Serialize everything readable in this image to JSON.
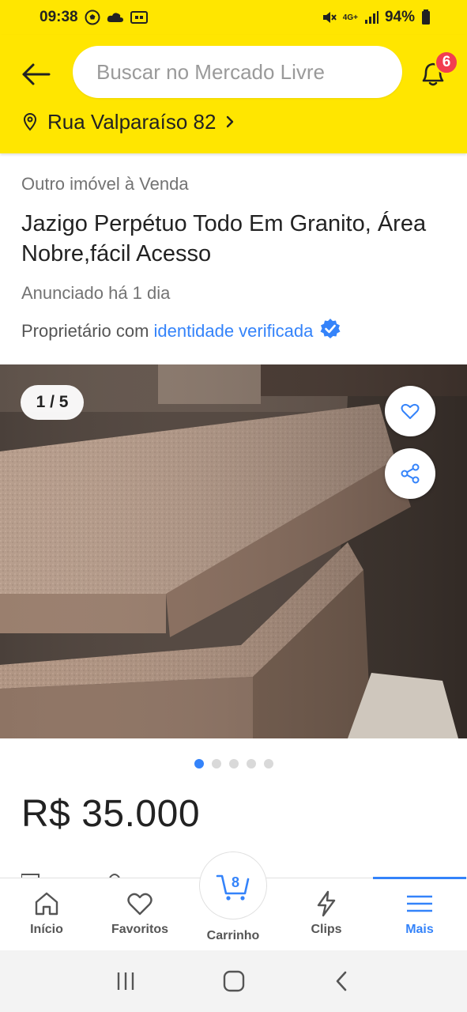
{
  "status_bar": {
    "time": "09:38",
    "network": "4G+",
    "battery": "94%"
  },
  "header": {
    "search_placeholder": "Buscar no Mercado Livre",
    "notifications_count": "6",
    "address": "Rua Valparaíso 82"
  },
  "listing": {
    "category": "Outro imóvel à Venda",
    "title": "Jazigo Perpétuo Todo Em Granito, Área Nobre,fácil Acesso",
    "posted": "Anunciado há 1 dia",
    "owner_prefix": "Proprietário com ",
    "owner_link": "identidade verificada",
    "image_counter": "1 / 5",
    "image_total": 5,
    "image_active_index": 1,
    "price": "R$ 35.000"
  },
  "bottom_nav": {
    "items": [
      {
        "label": "Início",
        "icon": "home-icon"
      },
      {
        "label": "Favoritos",
        "icon": "heart-icon"
      },
      {
        "label": "Carrinho",
        "icon": "cart-icon",
        "badge": "8"
      },
      {
        "label": "Clips",
        "icon": "lightning-icon"
      },
      {
        "label": "Mais",
        "icon": "menu-icon",
        "active": true
      }
    ]
  },
  "colors": {
    "brand_yellow": "#ffe600",
    "accent_blue": "#3483fa",
    "badge_red": "#f23d4f"
  }
}
